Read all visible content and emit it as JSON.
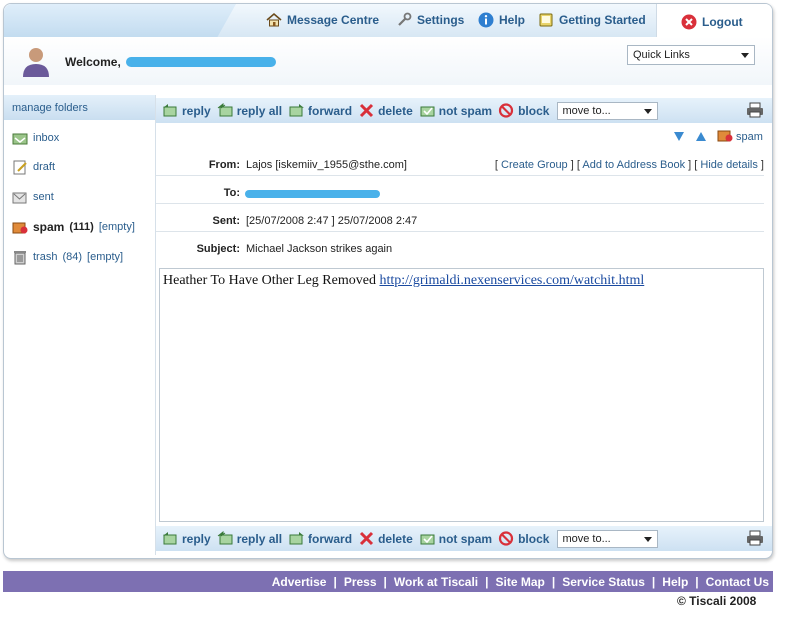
{
  "nav": {
    "message_centre": "Message Centre",
    "settings": "Settings",
    "help": "Help",
    "getting_started": "Getting Started",
    "logout": "Logout"
  },
  "welcome": {
    "label": "Welcome,"
  },
  "quick_links": {
    "selected": "Quick Links"
  },
  "sidebar": {
    "header": "manage folders",
    "items": [
      {
        "label": "inbox",
        "icon": "inbox-icon"
      },
      {
        "label": "draft",
        "icon": "draft-icon"
      },
      {
        "label": "sent",
        "icon": "sent-icon"
      },
      {
        "label": "spam",
        "count": "(111)",
        "empty": "[empty]",
        "icon": "spam-folder-icon"
      },
      {
        "label": "trash",
        "count": "(84)",
        "empty": "[empty]",
        "icon": "trash-icon"
      }
    ]
  },
  "toolbar": {
    "reply": "reply",
    "reply_all": "reply all",
    "forward": "forward",
    "delete": "delete",
    "not_spam": "not spam",
    "block": "block",
    "move_to": "move to..."
  },
  "message": {
    "spam_label": "spam",
    "from_label": "From:",
    "from_value": "Lajos [iskemiiv_1955@sthe.com]",
    "create_group": "Create Group",
    "add_to_address_book": "Add to Address Book",
    "hide_details": "Hide details",
    "to_label": "To:",
    "sent_label": "Sent:",
    "sent_value": "[25/07/2008 2:47 ] 25/07/2008 2:47",
    "subject_label": "Subject:",
    "subject_value": "Michael Jackson strikes again",
    "body_text": "Heather To Have Other Leg Removed ",
    "body_link": "http://grimaldi.nexenservices.com/watchit.html"
  },
  "footer": {
    "links": [
      "Advertise",
      "Press",
      "Work at Tiscali",
      "Site Map",
      "Service Status",
      "Help",
      "Contact Us"
    ],
    "separator": "|",
    "copyright": "© Tiscali 2008"
  },
  "colors": {
    "link_blue": "#2a5d8c",
    "footer_purple": "#7d70b2",
    "redaction_blue": "#29a3e6",
    "logout_red": "#d9303a"
  }
}
